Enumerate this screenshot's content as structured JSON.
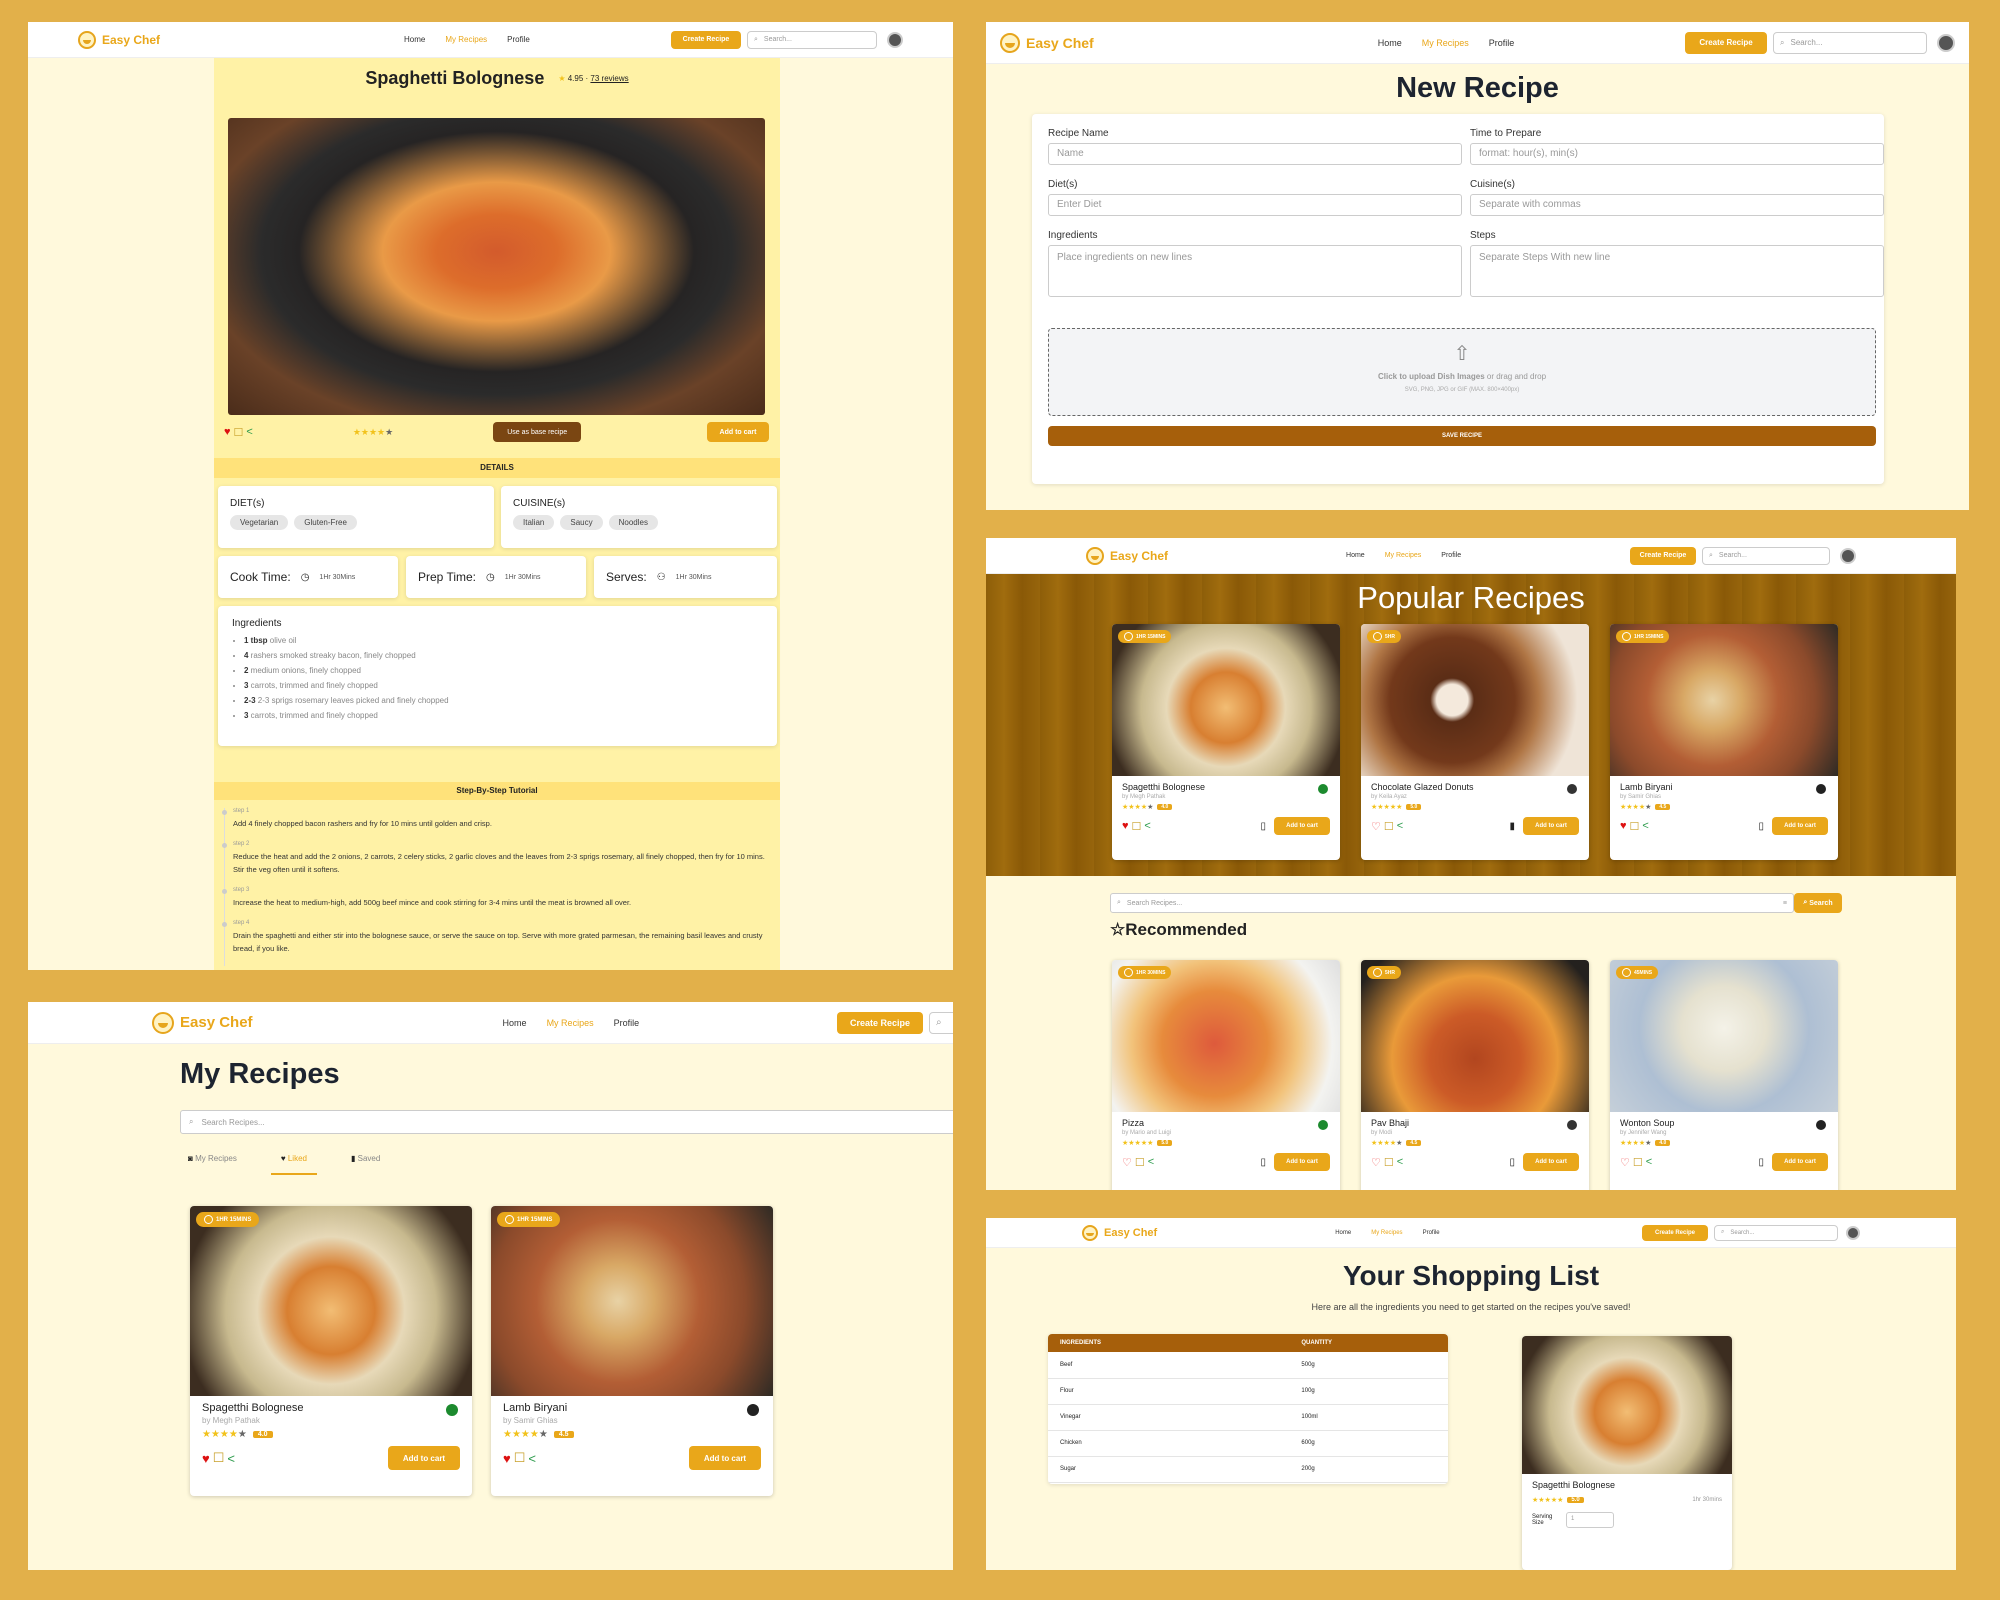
{
  "app": {
    "brand": "Easy Chef",
    "logo_sub": "easy chef",
    "nav": {
      "home": "Home",
      "my_recipes": "My Recipes",
      "profile": "Profile"
    },
    "create_recipe": "Create Recipe",
    "search_placeholder": "Search..."
  },
  "colors": {
    "page_bg": "#e2b04a",
    "panel_bg": "#fff9dc",
    "accent": "#e9a71a",
    "dark_button": "#7a4612"
  },
  "detail": {
    "title": "Spaghetti Bolognese",
    "rating": "4.95",
    "reviews": "73 reviews",
    "stars": 4,
    "use_base": "Use as base recipe",
    "add_to_cart": "Add to cart",
    "details_heading": "DETAILS",
    "diet_label": "DIET(s)",
    "diets": [
      "Vegetarian",
      "Gluten-Free"
    ],
    "cuisine_label": "CUISINE(s)",
    "cuisines": [
      "Italian",
      "Saucy",
      "Noodles"
    ],
    "cook_label": "Cook Time:",
    "cook_value": "1Hr 30Mins",
    "prep_label": "Prep Time:",
    "prep_value": "1Hr 30Mins",
    "serves_label": "Serves:",
    "serves_value": "1Hr 30Mins",
    "ingredients_heading": "Ingredients",
    "ingredients": [
      {
        "qty": "1 tbsp",
        "text": " olive oil"
      },
      {
        "qty": "4",
        "text": " rashers smoked streaky bacon, finely chopped"
      },
      {
        "qty": "2",
        "text": " medium onions, finely chopped"
      },
      {
        "qty": "3",
        "text": " carrots, trimmed and finely chopped"
      },
      {
        "qty": "2-3",
        "text": " 2-3 sprigs rosemary leaves picked and finely chopped"
      },
      {
        "qty": "3",
        "text": " carrots, trimmed and finely chopped"
      }
    ],
    "tutorial_heading": "Step-By-Step Tutorial",
    "steps": [
      {
        "label": "step 1",
        "text": "Add 4 finely chopped bacon rashers and fry for 10 mins until golden and crisp."
      },
      {
        "label": "step 2",
        "text": "Reduce the heat and add the 2 onions, 2 carrots, 2 celery sticks, 2 garlic cloves and the leaves from 2-3 sprigs rosemary, all finely chopped, then fry for 10 mins. Stir the veg often until it softens."
      },
      {
        "label": "step 3",
        "text": "Increase the heat to medium-high, add 500g beef mince and cook stirring for 3-4 mins until the meat is browned all over."
      },
      {
        "label": "step 4",
        "text": "Drain the spaghetti and either stir into the bolognese sauce, or serve the sauce on top. Serve with more grated parmesan, the remaining basil leaves and crusty bread, if you like."
      }
    ]
  },
  "new_recipe": {
    "title": "New Recipe",
    "name_label": "Recipe Name",
    "name_placeholder": "Name",
    "time_label": "Time to Prepare",
    "time_placeholder": "format: hour(s), min(s)",
    "diet_label": "Diet(s)",
    "diet_placeholder": "Enter Diet",
    "cuisine_label": "Cuisine(s)",
    "cuisine_placeholder": "Separate with commas",
    "ingredients_label": "Ingredients",
    "ingredients_placeholder": "Place ingredients on new lines",
    "steps_label": "Steps",
    "steps_placeholder": "Separate Steps With new line",
    "upload_strong": "Click to upload Dish Images",
    "upload_rest": " or drag and drop",
    "upload_hint": "SVG, PNG, JPG or GIF (MAX. 800×400px)",
    "save": "SAVE RECIPE"
  },
  "home": {
    "popular_title": "Popular Recipes",
    "popular": [
      {
        "time": "1HR 15MINS",
        "name": "Spagetthi Bolognese",
        "by": "by Megh Pathak",
        "rating": "4.0",
        "stars": 4,
        "diet_color": "#1c8a2e",
        "liked": true,
        "saved": false
      },
      {
        "time": "5HR",
        "name": "Chocolate Glazed Donuts",
        "by": "by Keila Ayaz",
        "rating": "5.0",
        "stars": 5,
        "diet_color": "#333333",
        "liked": false,
        "saved": true
      },
      {
        "time": "1HR 15MINS",
        "name": "Lamb Biryani",
        "by": "by Samir Ghias",
        "rating": "4.5",
        "stars": 4,
        "diet_color": "#222222",
        "liked": true,
        "saved": false
      }
    ],
    "search_placeholder": "Search Recipes...",
    "search_button": "Search",
    "recommended_title": "Recommended",
    "recommended": [
      {
        "time": "1HR 30MINS",
        "name": "Pizza",
        "by": "by Mario and Luigi",
        "rating": "5.0",
        "stars": 5,
        "diet_color": "#1c8a2e"
      },
      {
        "time": "5HR",
        "name": "Pav Bhaji",
        "by": "by Modi",
        "rating": "4.5",
        "stars": 4,
        "diet_color": "#333333"
      },
      {
        "time": "45MINS",
        "name": "Wonton Soup",
        "by": "by Jennifer Wang",
        "rating": "4.0",
        "stars": 4,
        "diet_color": "#222222"
      }
    ],
    "add_to_cart": "Add to cart"
  },
  "my_recipes": {
    "title": "My Recipes",
    "search_placeholder": "Search Recipes...",
    "tabs": [
      "My Recipes",
      "Liked",
      "Saved"
    ],
    "cards": [
      {
        "time": "1HR 15MINS",
        "name": "Spagetthi Bolognese",
        "by": "by Megh Pathak",
        "rating": "4.0"
      },
      {
        "time": "1HR 15MINS",
        "name": "Lamb Biryani",
        "by": "by Samir Ghias",
        "rating": "4.5"
      }
    ],
    "add_to_cart": "Add to cart"
  },
  "shopping": {
    "title": "Your Shopping List",
    "subtitle": "Here are all the ingredients you need to get started on the recipes you've saved!",
    "col_ingredient": "INGREDIENTS",
    "col_quantity": "QUANTITY",
    "rows": [
      {
        "name": "Beef",
        "qty": "500g"
      },
      {
        "name": "Flour",
        "qty": "100g"
      },
      {
        "name": "Vinegar",
        "qty": "100ml"
      },
      {
        "name": "Chicken",
        "qty": "600g"
      },
      {
        "name": "Sugar",
        "qty": "200g"
      }
    ],
    "card_name": "Spagetthi Bolognese",
    "card_rating": "5.0",
    "card_time": "1hr 30mins",
    "serving_label": "Serving Size",
    "serving_value": "1"
  }
}
